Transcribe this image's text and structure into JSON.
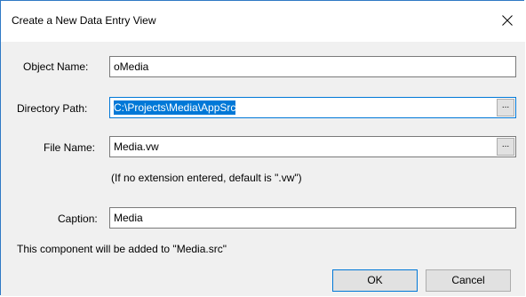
{
  "window": {
    "title": "Create a New Data Entry View",
    "close_icon": "close-icon"
  },
  "form": {
    "object_name": {
      "label": "Object Name:",
      "value": "oMedia"
    },
    "directory_path": {
      "label": "Directory Path:",
      "value": "C:\\Projects\\Media\\AppSrc",
      "selected": true,
      "browse_label": "..."
    },
    "file_name": {
      "label": "File Name:",
      "value": "Media.vw",
      "browse_label": "..."
    },
    "extension_hint": "(If no extension entered, default is \".vw\")",
    "caption": {
      "label": "Caption:",
      "value": "Media"
    }
  },
  "status_text": "This component will be added to \"Media.src\"",
  "buttons": {
    "ok": "OK",
    "cancel": "Cancel"
  },
  "colors": {
    "accent": "#0078d7",
    "selection_text": "#ffffff",
    "dialog_bg": "#f0f0f0"
  }
}
